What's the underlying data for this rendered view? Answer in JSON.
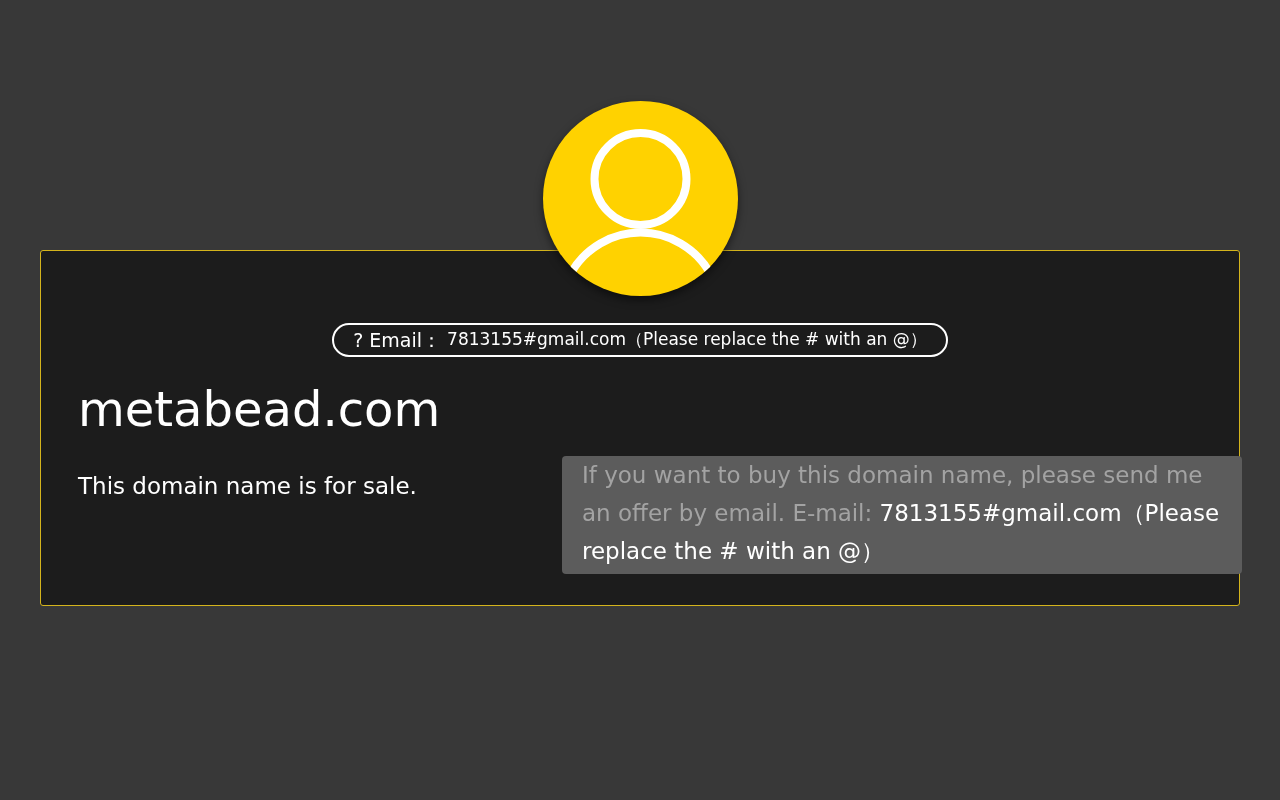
{
  "contact_pill": {
    "label": "? Email：",
    "value": "7813155#gmail.com（Please replace the # with an @）"
  },
  "domain": "metabead.com",
  "sale_note": "This domain name is for sale.",
  "offer": {
    "intro": "If you want to buy this domain name, please send me an offer by email. E-mail: ",
    "email": "7813155#gmail.com（Please replace the # with an @）"
  }
}
